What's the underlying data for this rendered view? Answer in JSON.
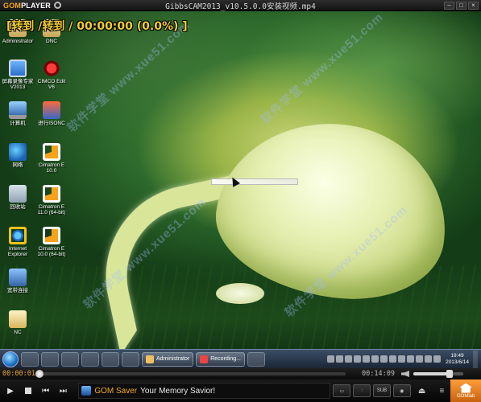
{
  "window": {
    "logo_prefix": "GOM",
    "logo_suffix": "PLAYER",
    "title": "GibbsCAM2013_v10.5.0.0安装视频.mp4",
    "btn_min": "–",
    "btn_max": "□",
    "btn_close": "×"
  },
  "osd": {
    "text": "[转到 /转到 / 00:00:00 (0.0%) ]"
  },
  "watermark": "软件学堂  www.xue51.com",
  "desktop_icons": [
    {
      "label": "Administrator"
    },
    {
      "label": "DNC"
    },
    {
      "label": "屏幕录像专家 V2013"
    },
    {
      "label": "CIMCO Edit V6"
    },
    {
      "label": "计算机"
    },
    {
      "label": "进行ISONC"
    },
    {
      "label": "网络"
    },
    {
      "label": "Cimatron E 10.0"
    },
    {
      "label": "回收站"
    },
    {
      "label": "Cimatron E 11.0 (64-bit)"
    },
    {
      "label": "Internet Explorer"
    },
    {
      "label": "Cimatron E 10.0 (64-bit)"
    },
    {
      "label": "宽带连接"
    },
    {
      "label": "NC"
    }
  ],
  "taskbar": {
    "tasks": [
      {
        "label": "Administrator"
      },
      {
        "label": "Recording..."
      }
    ],
    "clock_time": "19:49",
    "clock_date": "2013/6/14"
  },
  "seek": {
    "current": "00:00:01",
    "total": "00:14:09",
    "progress": 0.0
  },
  "volume": {
    "level": 0.72
  },
  "controls": {
    "play_glyph": "▶",
    "prev_glyph": "⏮",
    "next_glyph": "⏭",
    "ad_brand": "GOM Saver",
    "ad_text": "Your Memory Savior!",
    "sub_label": "SUB",
    "eject_glyph": "⏏",
    "menu_glyph": "≡",
    "gomlab_label": "GOMlab"
  },
  "colors": {
    "accent": "#f5a623",
    "osd_text": "#f2ce33"
  }
}
